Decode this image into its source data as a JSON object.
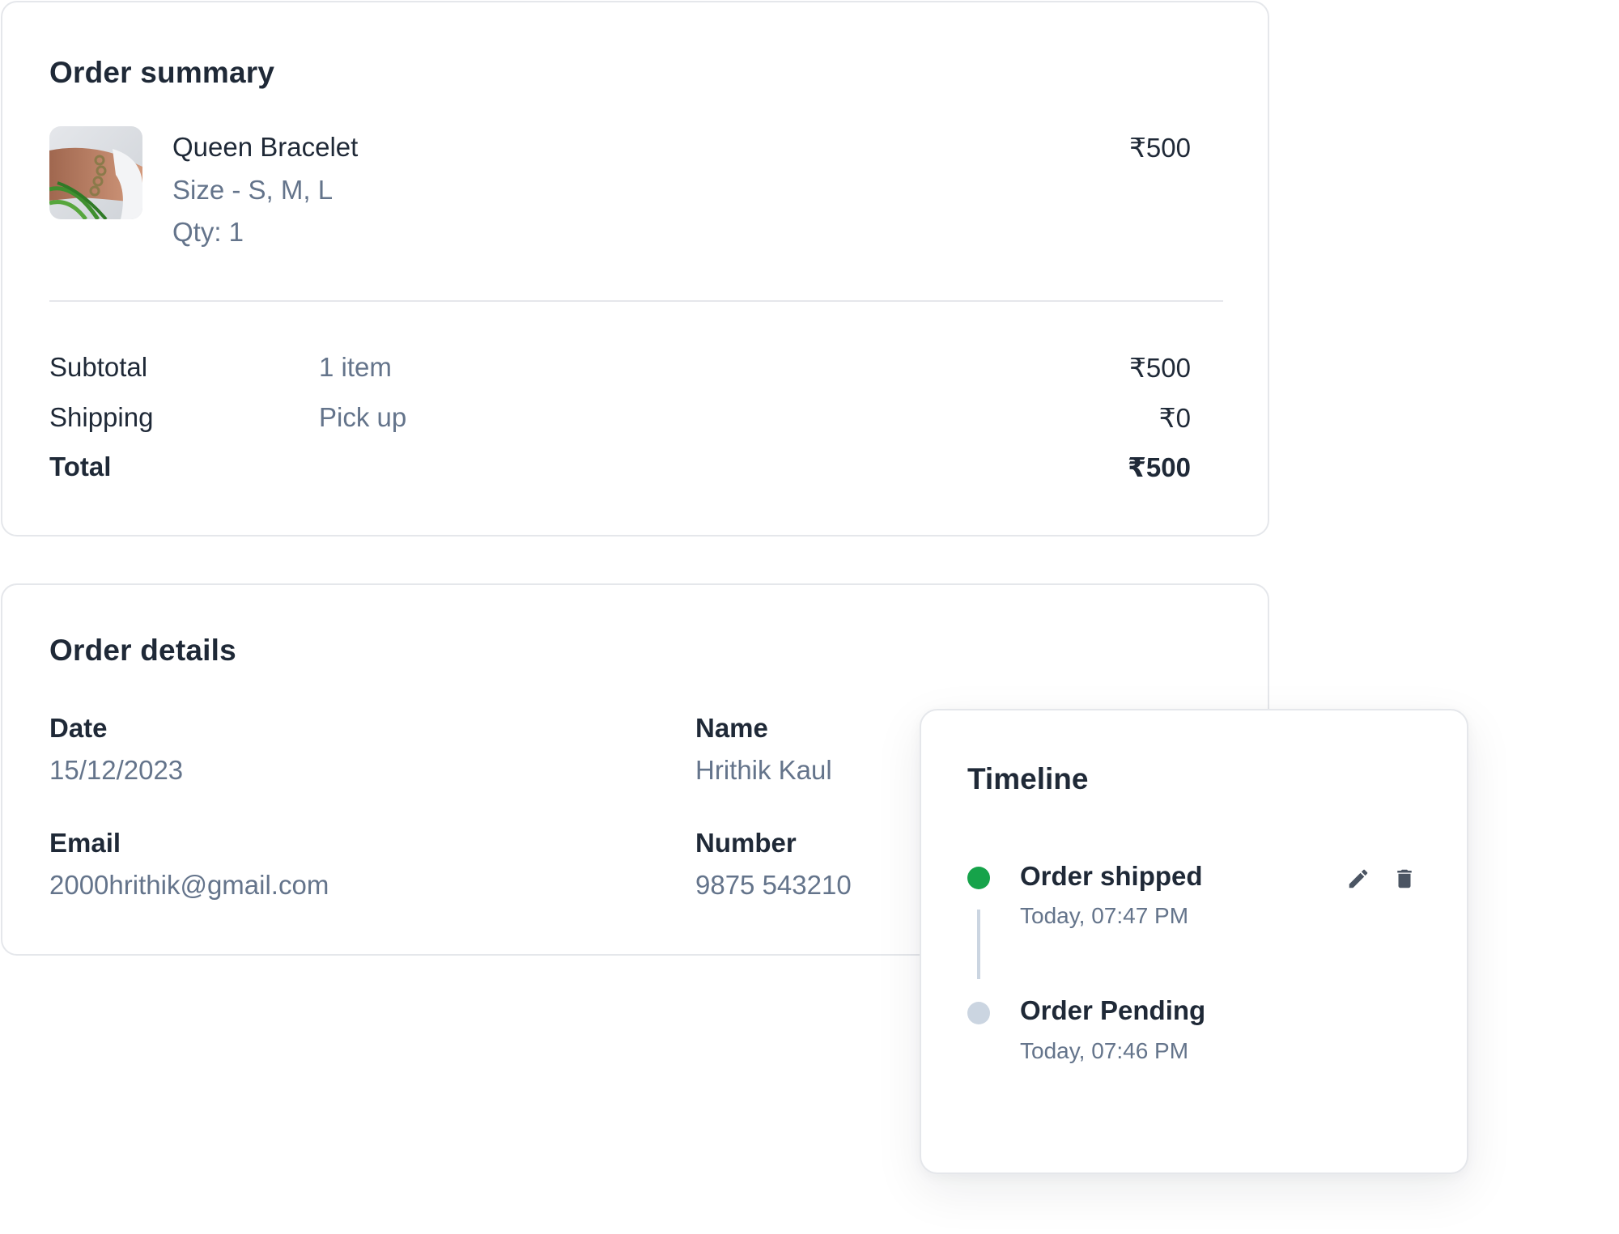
{
  "summary": {
    "title": "Order summary",
    "product": {
      "name": "Queen Bracelet",
      "size": "Size - S, M, L",
      "qty": "Qty: 1",
      "price": "₹500"
    },
    "rows": {
      "subtotal": {
        "label": "Subtotal",
        "note": "1 item",
        "value": "₹500"
      },
      "shipping": {
        "label": "Shipping",
        "note": "Pick up",
        "value": "₹0"
      },
      "total": {
        "label": "Total",
        "value": "₹500"
      }
    }
  },
  "details": {
    "title": "Order details",
    "date": {
      "label": "Date",
      "value": "15/12/2023"
    },
    "name": {
      "label": "Name",
      "value": "Hrithik Kaul"
    },
    "email": {
      "label": "Email",
      "value": "2000hrithik@gmail.com"
    },
    "number": {
      "label": "Number",
      "value": "9875 543210"
    }
  },
  "timeline": {
    "title": "Timeline",
    "events": [
      {
        "title": "Order shipped",
        "time": "Today, 07:47 PM",
        "status_color": "#16a34a"
      },
      {
        "title": "Order Pending",
        "time": "Today, 07:46 PM",
        "status_color": "#cbd5e1"
      }
    ]
  },
  "icons": {
    "edit": "pencil-icon",
    "delete": "trash-icon"
  }
}
